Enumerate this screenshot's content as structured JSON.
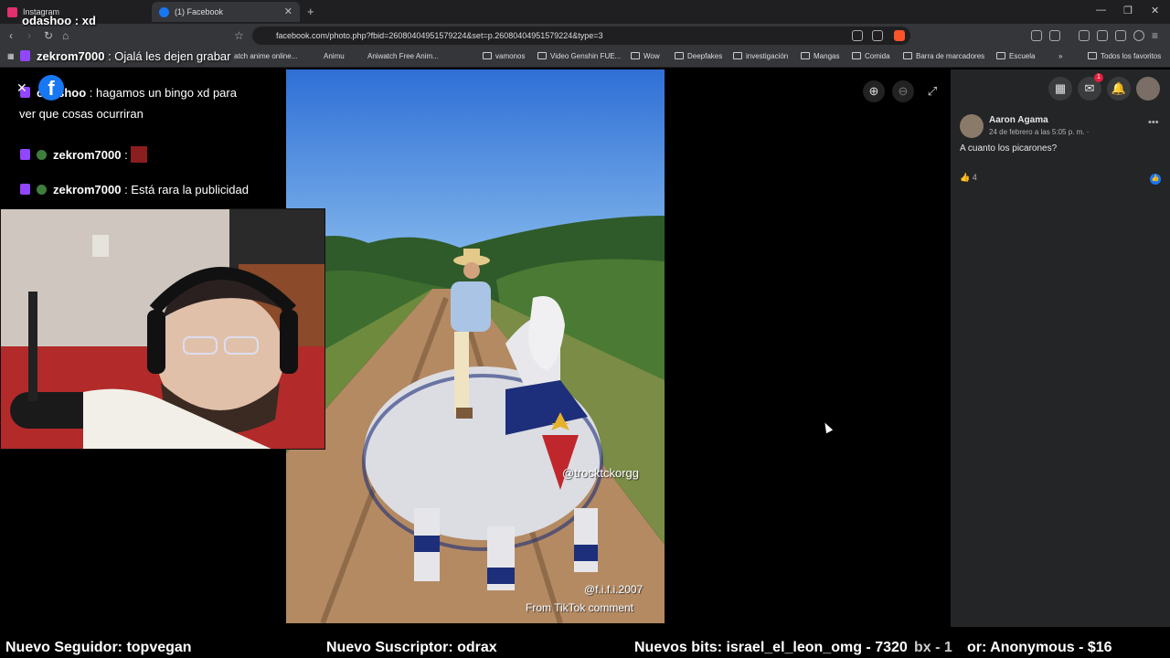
{
  "browser": {
    "tabs": [
      {
        "label": "Instagram",
        "favicon_color": "#e1306c"
      },
      {
        "label": "(1) Facebook",
        "favicon_color": "#1877f2"
      }
    ],
    "url": "facebook.com/photo.php?fbid=26080404951579224&set=p.26080404951579224&type=3",
    "new_tab_label": "+",
    "bookmarks": [
      {
        "label": "Animu"
      },
      {
        "label": "Aniwatch Free Anim..."
      },
      {
        "label": "vamonos"
      },
      {
        "label": "Video Genshin FUE..."
      },
      {
        "label": "Wow"
      },
      {
        "label": "Deepfakes"
      },
      {
        "label": "investigación"
      },
      {
        "label": "Mangas"
      },
      {
        "label": "Comida"
      },
      {
        "label": "Barra de marcadores"
      },
      {
        "label": "Escuela"
      },
      {
        "label": "Todos los favoritos"
      }
    ],
    "bookmark_partial": "atch anime online..."
  },
  "stream_overlay": {
    "title_user": "odashoo",
    "title_msg": ": xd",
    "chat": [
      {
        "user": "zekrom7000",
        "msg": ": Ojalá les dejen grabar"
      },
      {
        "user": "odashoo",
        "msg": ": hagamos un bingo xd para",
        "msg2": "ver que cosas ocurriran"
      },
      {
        "user": "zekrom7000",
        "msg": ":"
      },
      {
        "user": "zekrom7000",
        "msg": ": Está rara la publicidad"
      }
    ],
    "ticker": [
      {
        "text": "Nuevo Seguidor: topvegan"
      },
      {
        "text": "Nuevo Suscriptor: odrax"
      },
      {
        "text": "Nuevos bits: israel_el_leon_omg - 7320"
      },
      {
        "text": "bx - 1"
      },
      {
        "text": "or: Anonymous - $16"
      }
    ]
  },
  "photo": {
    "watermark": "@trocktckorgg",
    "signature": "@f.i.f.i.2007",
    "source": "From TikTok comment"
  },
  "comment": {
    "author": "Aaron Agama",
    "date": "24 de febrero a las 5:05 p. m. ·",
    "text": "A cuanto los picarones?",
    "likes": "4"
  },
  "fb_header": {
    "notification_count": "1"
  },
  "colors": {
    "fb_blue": "#1877f2",
    "panel_bg": "#242526",
    "twitch_purple": "#9146ff"
  }
}
